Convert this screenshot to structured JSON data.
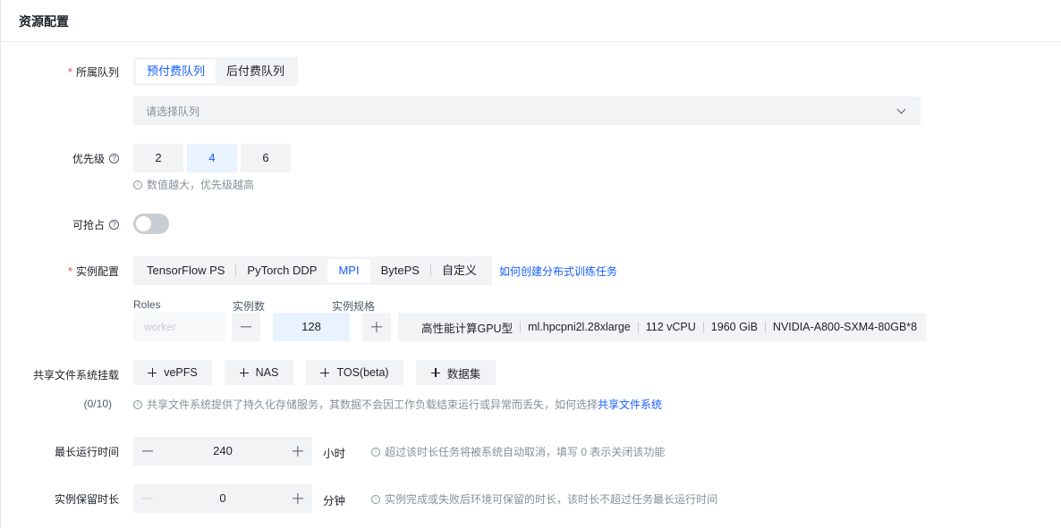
{
  "header": {
    "title": "资源配置"
  },
  "queue": {
    "label": "所属队列",
    "tabs": [
      "预付费队列",
      "后付费队列"
    ],
    "active_tab": 0,
    "select_placeholder": "请选择队列"
  },
  "priority": {
    "label": "优先级",
    "options": [
      "2",
      "4",
      "6"
    ],
    "selected": "4",
    "hint": "数值越大，优先级越高"
  },
  "preemptible": {
    "label": "可抢占",
    "enabled": false
  },
  "instance": {
    "label": "实例配置",
    "tabs": [
      "TensorFlow PS",
      "PyTorch DDP",
      "MPI",
      "BytePS",
      "自定义"
    ],
    "active_tab": "MPI",
    "help_link": "如何创建分布式训练任务",
    "col_roles": "Roles",
    "col_count": "实例数",
    "col_spec": "实例规格",
    "role_value": "worker",
    "count_value": "128",
    "spec": {
      "family": "高性能计算GPU型",
      "name": "ml.hpcpni2l.28xlarge",
      "cpu": "112 vCPU",
      "mem": "1960 GiB",
      "gpu": "NVIDIA-A800-SXM4-80GB*8"
    }
  },
  "storage": {
    "label": "共享文件系统挂载",
    "count": "(0/10)",
    "buttons": [
      "vePFS",
      "NAS",
      "TOS(beta)",
      "数据集"
    ],
    "hint": "共享文件系统提供了持久化存储服务，其数据不会因工作负载结束运行或异常而丢失，如何选择",
    "hint_link": "共享文件系统"
  },
  "max_runtime": {
    "label": "最长运行时间",
    "value": "240",
    "unit": "小时",
    "hint": "超过该时长任务将被系统自动取消，填写 0 表示关闭该功能"
  },
  "retention": {
    "label": "实例保留时长",
    "value": "0",
    "unit": "分钟",
    "hint": "实例完成或失败后环境可保留的时长，该时长不超过任务最长运行时间"
  },
  "icons": {
    "help": "question-circle-icon",
    "info": "info-circle-icon",
    "plus": "plus-icon",
    "minus": "minus-icon",
    "chevron": "chevron-down-icon"
  },
  "colors": {
    "primary": "#165dff",
    "required": "#f53f3f",
    "fill": "#f2f3f5"
  }
}
